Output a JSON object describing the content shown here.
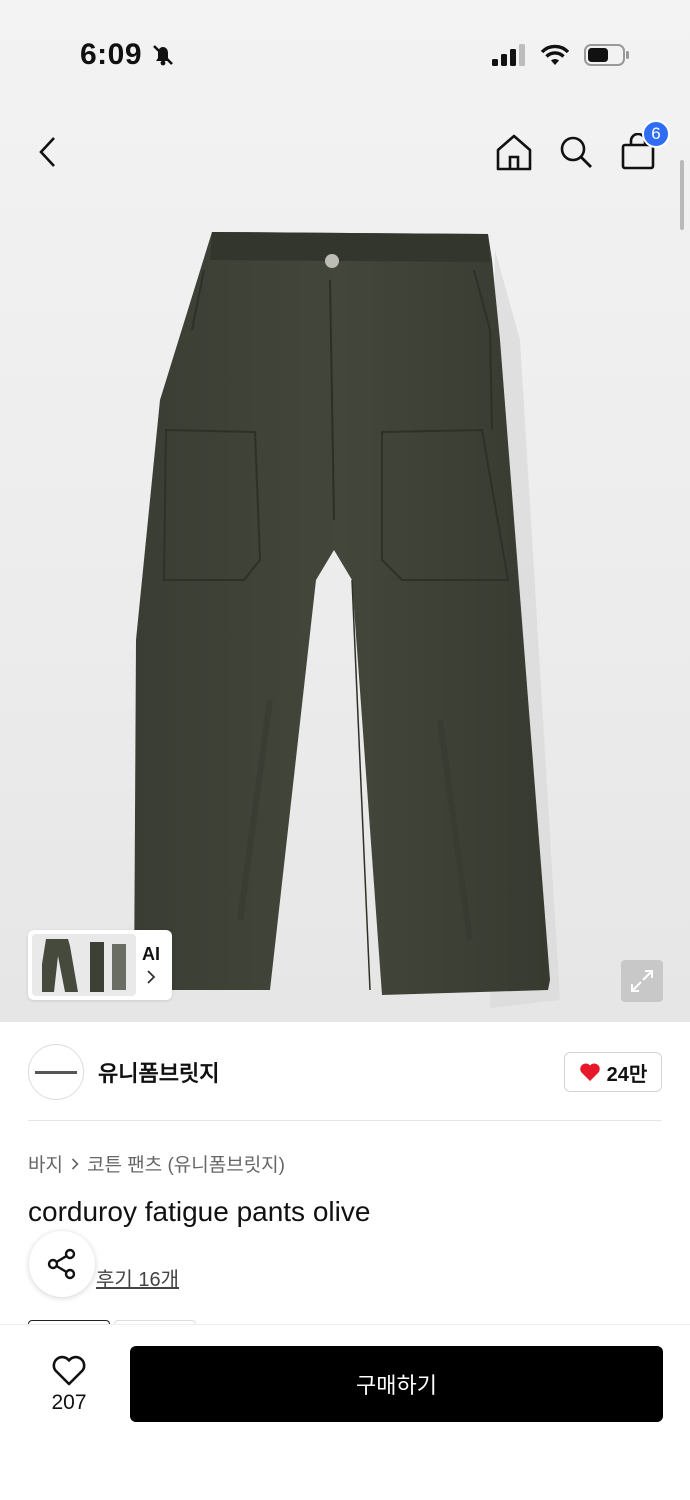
{
  "status_bar": {
    "time": "6:09"
  },
  "nav": {
    "cart_count": "6"
  },
  "gallery": {
    "ai_label": "AI"
  },
  "brand": {
    "name": "유니폼브릿지",
    "likes": "24만"
  },
  "breadcrumb": {
    "category": "바지",
    "subcategory": "코튼 팬츠 (유니폼브릿지)"
  },
  "product": {
    "title": "corduroy fatigue pants olive",
    "reviews": "후기 16개"
  },
  "bottom_bar": {
    "wish_count": "207",
    "buy_label": "구매하기"
  },
  "colors": {
    "pants": "#3d4035",
    "badge": "#2f6df6",
    "heart": "#e8182c",
    "buy_button": "#000000"
  }
}
